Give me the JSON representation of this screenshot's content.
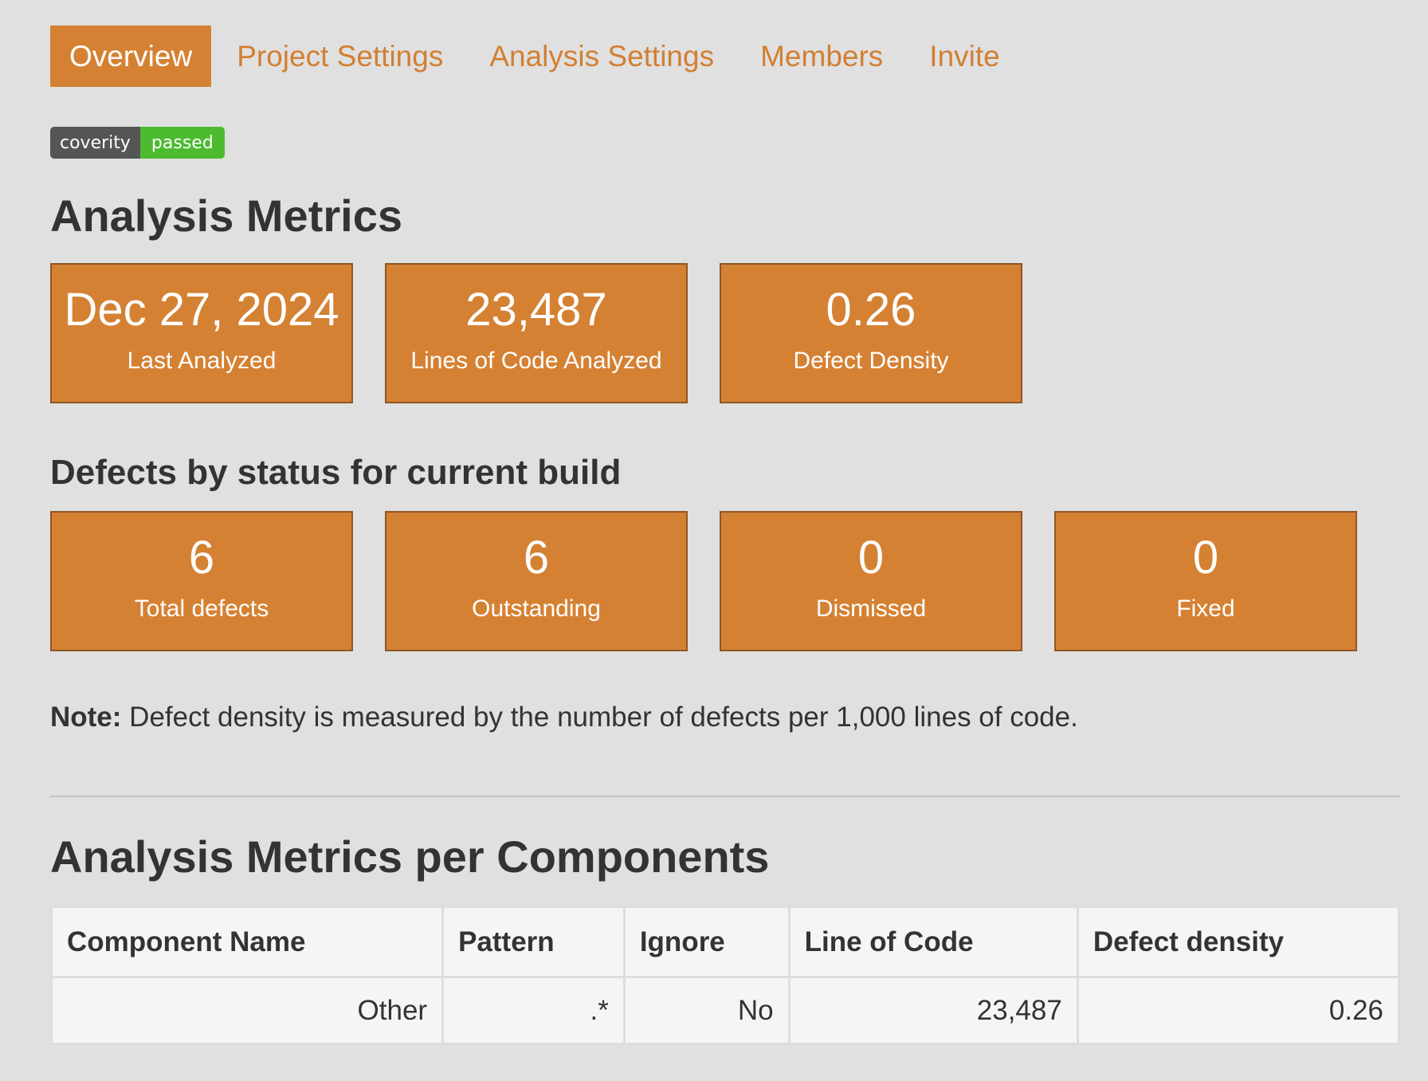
{
  "tabs": [
    {
      "label": "Overview",
      "active": true
    },
    {
      "label": "Project Settings",
      "active": false
    },
    {
      "label": "Analysis Settings",
      "active": false
    },
    {
      "label": "Members",
      "active": false
    },
    {
      "label": "Invite",
      "active": false
    }
  ],
  "badge": {
    "left": "coverity",
    "right": "passed"
  },
  "analysis_metrics": {
    "title": "Analysis Metrics",
    "cards": [
      {
        "value": "Dec 27, 2024",
        "label": "Last Analyzed"
      },
      {
        "value": "23,487",
        "label": "Lines of Code Analyzed"
      },
      {
        "value": "0.26",
        "label": "Defect Density"
      }
    ]
  },
  "defects": {
    "title": "Defects by status for current build",
    "cards": [
      {
        "value": "6",
        "label": "Total defects"
      },
      {
        "value": "6",
        "label": "Outstanding"
      },
      {
        "value": "0",
        "label": "Dismissed"
      },
      {
        "value": "0",
        "label": "Fixed"
      }
    ]
  },
  "note": {
    "prefix": "Note:",
    "text": " Defect density is measured by the number of defects per 1,000 lines of code."
  },
  "components": {
    "title": "Analysis Metrics per Components",
    "headers": [
      "Component Name",
      "Pattern",
      "Ignore",
      "Line of Code",
      "Defect density"
    ],
    "rows": [
      [
        "Other",
        ".*",
        "No",
        "23,487",
        "0.26"
      ]
    ]
  },
  "colors": {
    "accent": "#d58133",
    "accent_text": "#d27f32",
    "badge_left": "#555555",
    "badge_right": "#4dbb2f",
    "background": "#e0e0e0"
  }
}
